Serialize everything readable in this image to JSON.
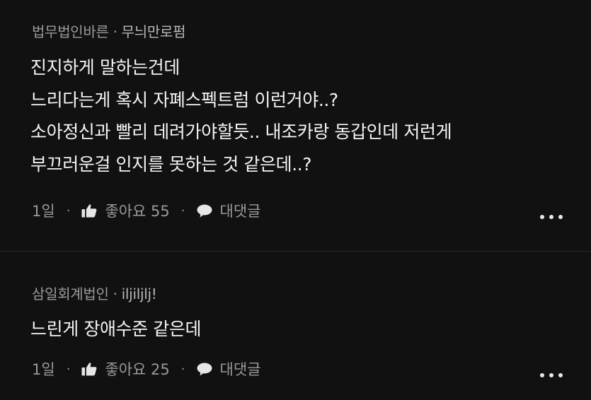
{
  "comments": [
    {
      "company": "법무법인바른",
      "separator": "·",
      "nickname": "무늬만로펌",
      "lines": [
        "진지하게 말하는건데",
        "느리다는게 혹시 자폐스펙트럼 이런거야..?",
        "소아정신과 빨리 데려가야할듯.. 내조카랑 동갑인데 저런게",
        "부끄러운걸 인지를 못하는 것 같은데..?"
      ],
      "time": "1일",
      "like_label": "좋아요 55",
      "reply_label": "대댓글",
      "icons": {
        "like": "thumbs-up-icon",
        "reply": "speech-bubble-icon",
        "more": "more-horizontal-icon"
      }
    },
    {
      "company": "삼일회계법인",
      "separator": "·",
      "nickname": "iljiljlj!",
      "lines": [
        "느린게 장애수준 같은데"
      ],
      "time": "1일",
      "like_label": "좋아요 25",
      "reply_label": "대댓글",
      "icons": {
        "like": "thumbs-up-icon",
        "reply": "speech-bubble-icon",
        "more": "more-horizontal-icon"
      }
    }
  ],
  "meta_separator": "·",
  "colors": {
    "background": "#111111",
    "text": "#f4f4f4",
    "muted": "#9a9a9a",
    "divider": "#262626"
  }
}
